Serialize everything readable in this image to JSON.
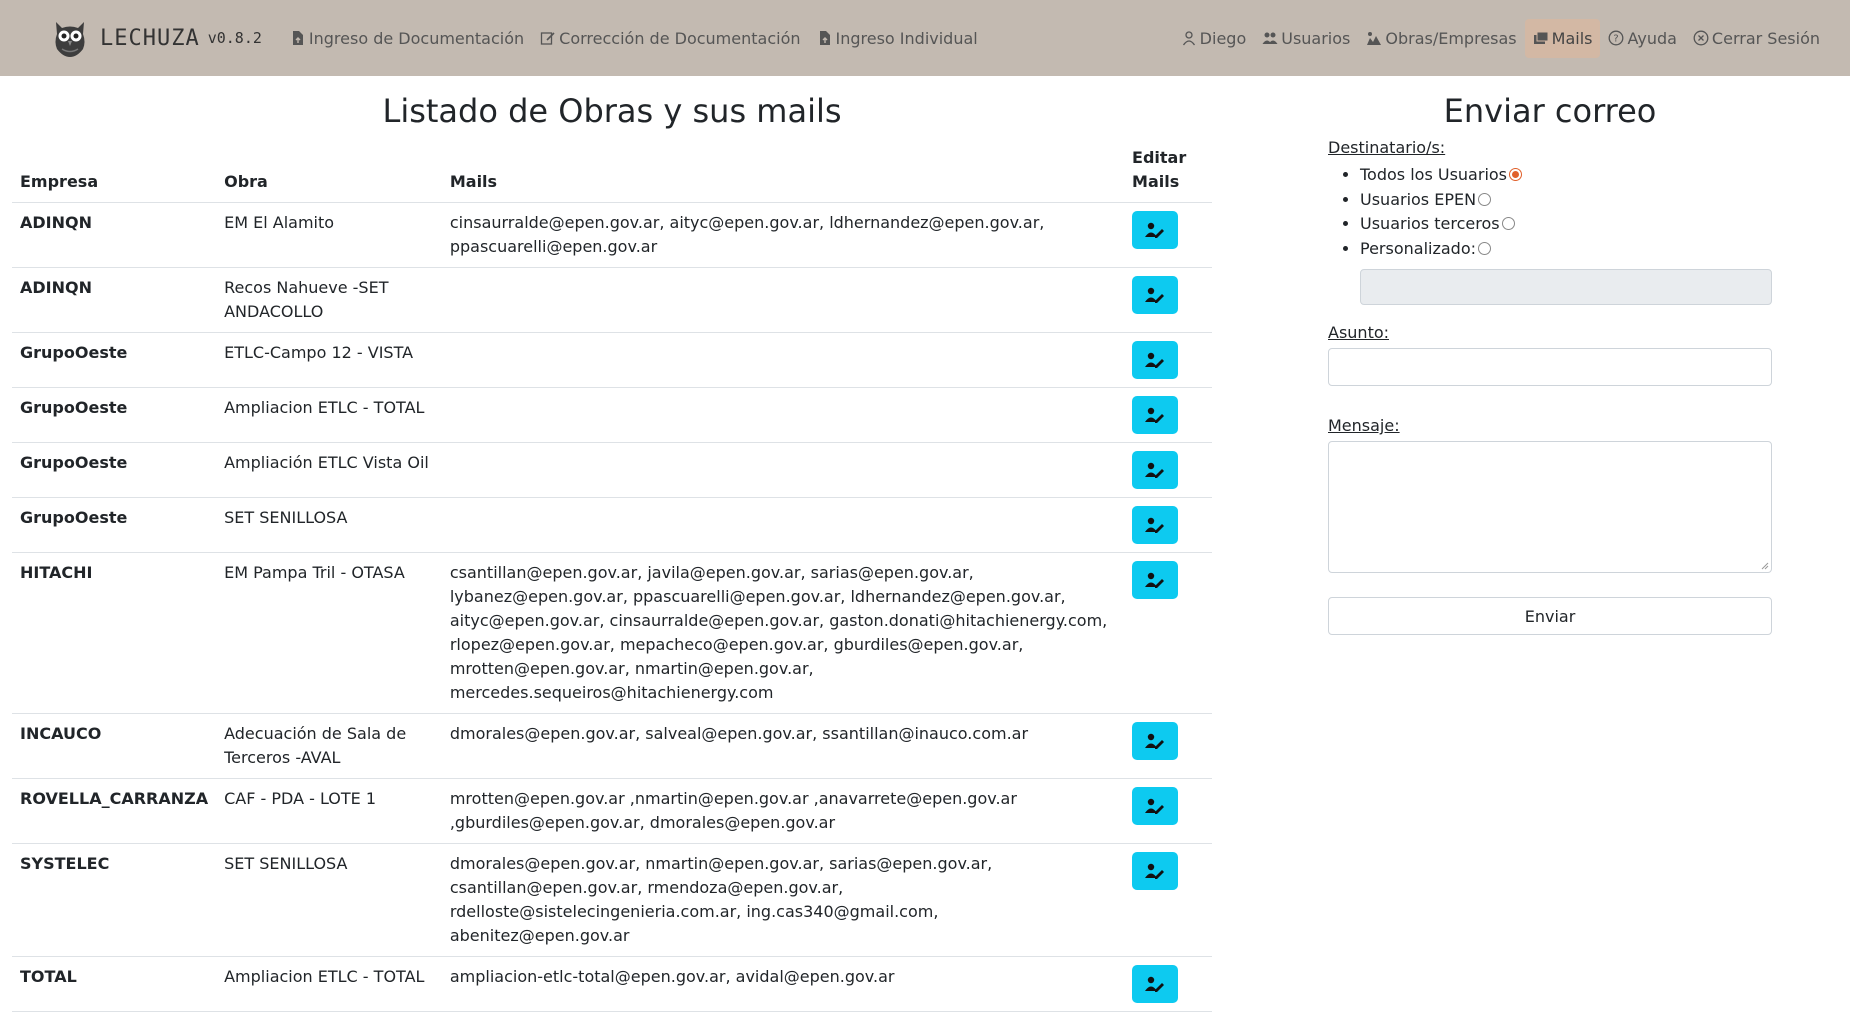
{
  "brand": {
    "name": "LECHUZA",
    "version": "v0.8.2"
  },
  "nav_left": [
    {
      "label": "Ingreso de Documentación",
      "icon": "file-upload-icon"
    },
    {
      "label": "Corrección de Documentación",
      "icon": "edit-icon"
    },
    {
      "label": "Ingreso Individual",
      "icon": "file-upload-icon"
    }
  ],
  "nav_right": [
    {
      "label": "Diego",
      "icon": "user-icon"
    },
    {
      "label": "Usuarios",
      "icon": "users-icon"
    },
    {
      "label": "Obras/Empresas",
      "icon": "construction-icon"
    },
    {
      "label": "Mails",
      "icon": "mail-icon",
      "active": true
    },
    {
      "label": "Ayuda",
      "icon": "help-icon"
    },
    {
      "label": "Cerrar Sesión",
      "icon": "close-circle-icon"
    }
  ],
  "list": {
    "title": "Listado de Obras y sus mails",
    "headers": {
      "empresa": "Empresa",
      "obra": "Obra",
      "mails": "Mails",
      "edit": "Editar Mails"
    },
    "rows": [
      {
        "empresa": "ADINQN",
        "obra": "EM El Alamito",
        "mails": "cinsaurralde@epen.gov.ar, aityc@epen.gov.ar, ldhernandez@epen.gov.ar, ppascuarelli@epen.gov.ar"
      },
      {
        "empresa": "ADINQN",
        "obra": "Recos Nahueve -SET ANDACOLLO",
        "mails": ""
      },
      {
        "empresa": "GrupoOeste",
        "obra": "ETLC-Campo 12 - VISTA",
        "mails": ""
      },
      {
        "empresa": "GrupoOeste",
        "obra": "Ampliacion ETLC - TOTAL",
        "mails": ""
      },
      {
        "empresa": "GrupoOeste",
        "obra": "Ampliación ETLC Vista Oil",
        "mails": ""
      },
      {
        "empresa": "GrupoOeste",
        "obra": "SET SENILLOSA",
        "mails": ""
      },
      {
        "empresa": "HITACHI",
        "obra": "EM Pampa Tril - OTASA",
        "mails": "csantillan@epen.gov.ar, javila@epen.gov.ar, sarias@epen.gov.ar, lybanez@epen.gov.ar, ppascuarelli@epen.gov.ar, ldhernandez@epen.gov.ar, aityc@epen.gov.ar, cinsaurralde@epen.gov.ar, gaston.donati@hitachienergy.com, rlopez@epen.gov.ar, mepacheco@epen.gov.ar, gburdiles@epen.gov.ar, mrotten@epen.gov.ar, nmartin@epen.gov.ar, mercedes.sequeiros@hitachienergy.com"
      },
      {
        "empresa": "INCAUCO",
        "obra": "Adecuación de Sala de Terceros -AVAL",
        "mails": "dmorales@epen.gov.ar, salveal@epen.gov.ar, ssantillan@inauco.com.ar"
      },
      {
        "empresa": "ROVELLA_CARRANZA",
        "obra": "CAF - PDA - LOTE 1",
        "mails": "mrotten@epen.gov.ar ,nmartin@epen.gov.ar ,anavarrete@epen.gov.ar ,gburdiles@epen.gov.ar, dmorales@epen.gov.ar"
      },
      {
        "empresa": "SYSTELEC",
        "obra": "SET SENILLOSA",
        "mails": "dmorales@epen.gov.ar, nmartin@epen.gov.ar, sarias@epen.gov.ar, csantillan@epen.gov.ar, rmendoza@epen.gov.ar, rdelloste@sistelecingenieria.com.ar, ing.cas340@gmail.com, abenitez@epen.gov.ar"
      },
      {
        "empresa": "TOTAL",
        "obra": "Ampliacion ETLC - TOTAL",
        "mails": "ampliacion-etlc-total@epen.gov.ar, avidal@epen.gov.ar"
      }
    ]
  },
  "send": {
    "title": "Enviar correo",
    "recipients_label": "Destinatario/s:",
    "options": [
      {
        "label": "Todos los Usuarios",
        "checked": true
      },
      {
        "label": "Usuarios EPEN",
        "checked": false
      },
      {
        "label": "Usuarios terceros",
        "checked": false
      },
      {
        "label": "Personalizado:",
        "checked": false
      }
    ],
    "custom_value": "",
    "subject_label": "Asunto:",
    "subject_value": "",
    "message_label": "Mensaje:",
    "message_value": "",
    "send_label": "Enviar"
  },
  "colors": {
    "navbar": "#c3bab1",
    "nav_active": "#d3b8a4",
    "edit_button": "#0dcaf0",
    "radio_checked": "#e0602a"
  }
}
